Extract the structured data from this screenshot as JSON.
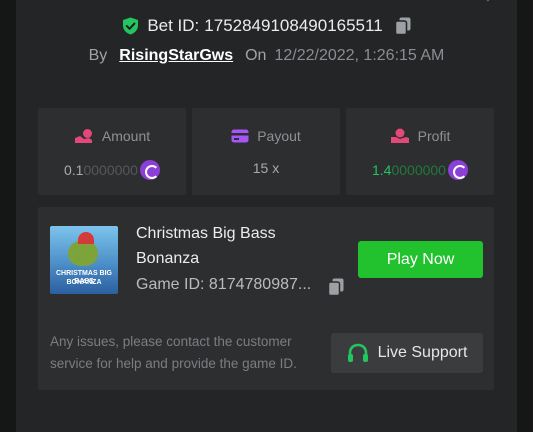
{
  "bet": {
    "label": "Bet ID:",
    "id": "1752849108490165511"
  },
  "byline": {
    "by": "By",
    "user": "RisingStarGws",
    "on": "On",
    "date": "12/22/2022, 1:26:15 AM"
  },
  "stats": {
    "amount": {
      "label": "Amount",
      "value_main": "0.1",
      "value_fade": "0000000"
    },
    "payout": {
      "label": "Payout",
      "value": "15 x"
    },
    "profit": {
      "label": "Profit",
      "value_main": "1.4",
      "value_fade": "0000000"
    }
  },
  "game": {
    "title": "Christmas Big Bass Bonanza",
    "thumb_line1": "CHRISTMAS BIG BASS",
    "thumb_line2": "BONANZA",
    "id_label": "Game ID: 8174780987..."
  },
  "buttons": {
    "play": "Play Now",
    "support": "Live Support"
  },
  "issue_text": "Any issues, please contact the customer service for help and provide the game ID.",
  "colors": {
    "accent_green": "#22c22e",
    "profit_green": "#22c55e",
    "coin_purple": "#8b3fd6",
    "amount_icon": "#e2497a",
    "payout_icon": "#a855f7",
    "profit_icon": "#e2497a",
    "shield_green": "#22c55e"
  },
  "icons": {
    "shield": "shield-check-icon",
    "copy": "copy-icon",
    "amount": "bet-amount-icon",
    "payout": "card-icon",
    "profit": "profit-hand-icon",
    "coin": "coin-icon",
    "headset": "headset-icon"
  }
}
